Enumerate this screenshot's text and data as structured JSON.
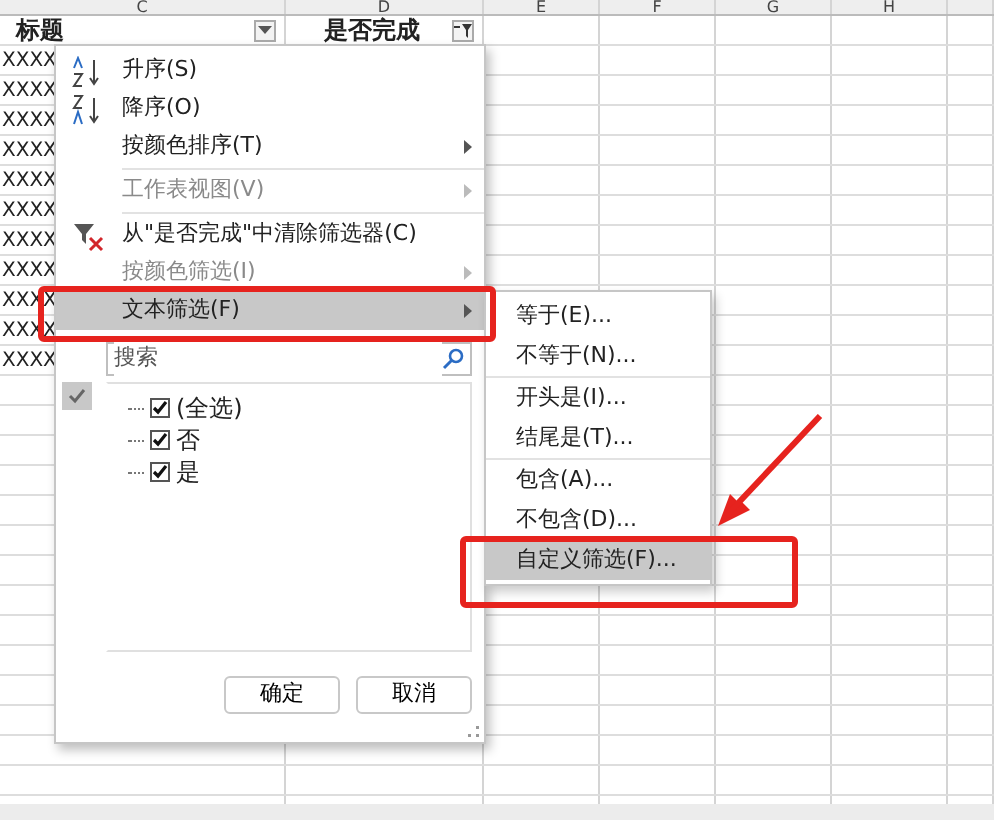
{
  "columns": [
    {
      "label": "C"
    },
    {
      "label": "D"
    },
    {
      "label": "E"
    },
    {
      "label": "F"
    },
    {
      "label": "G"
    },
    {
      "label": "H"
    }
  ],
  "header": {
    "title": "标题",
    "done": "是否完成",
    "done_filtered": true
  },
  "rows": [
    "XXXX",
    "XXXX",
    "XXXX",
    "XXXX",
    "XXXX",
    "XXXX",
    "XXXX",
    "XXXX",
    "XXXX",
    "XXXX",
    "XXXX"
  ],
  "menu": {
    "items": [
      {
        "kind": "sort-asc",
        "label": "升序(S)",
        "disabled": false,
        "submenu": false,
        "selected": false
      },
      {
        "kind": "sort-desc",
        "label": "降序(O)",
        "disabled": false,
        "submenu": false,
        "selected": false
      },
      {
        "kind": "plain",
        "label": "按颜色排序(T)",
        "disabled": false,
        "submenu": true,
        "selected": false
      },
      {
        "kind": "separator"
      },
      {
        "kind": "plain",
        "label": "工作表视图(V)",
        "disabled": true,
        "submenu": true,
        "selected": false
      },
      {
        "kind": "separator"
      },
      {
        "kind": "clear-filter",
        "label": "从\"是否完成\"中清除筛选器(C)",
        "disabled": false,
        "submenu": false,
        "selected": false
      },
      {
        "kind": "plain",
        "label": "按颜色筛选(I)",
        "disabled": true,
        "submenu": true,
        "selected": false
      },
      {
        "kind": "plain",
        "label": "文本筛选(F)",
        "disabled": false,
        "submenu": true,
        "selected": true
      }
    ],
    "search": {
      "placeholder": "搜索"
    },
    "values": [
      {
        "label": "(全选)",
        "checked": true
      },
      {
        "label": "否",
        "checked": true
      },
      {
        "label": "是",
        "checked": true
      }
    ],
    "buttons": [
      "确定",
      "取消"
    ]
  },
  "submenu": {
    "items": [
      {
        "kind": "item",
        "label": "等于(E)...",
        "selected": false
      },
      {
        "kind": "item",
        "label": "不等于(N)...",
        "selected": false
      },
      {
        "kind": "separator"
      },
      {
        "kind": "item",
        "label": "开头是(I)...",
        "selected": false
      },
      {
        "kind": "item",
        "label": "结尾是(T)...",
        "selected": false
      },
      {
        "kind": "separator"
      },
      {
        "kind": "item",
        "label": "包含(A)...",
        "selected": false
      },
      {
        "kind": "item",
        "label": "不包含(D)...",
        "selected": false
      },
      {
        "kind": "item",
        "label": "自定义筛选(F)...",
        "selected": true
      }
    ]
  }
}
